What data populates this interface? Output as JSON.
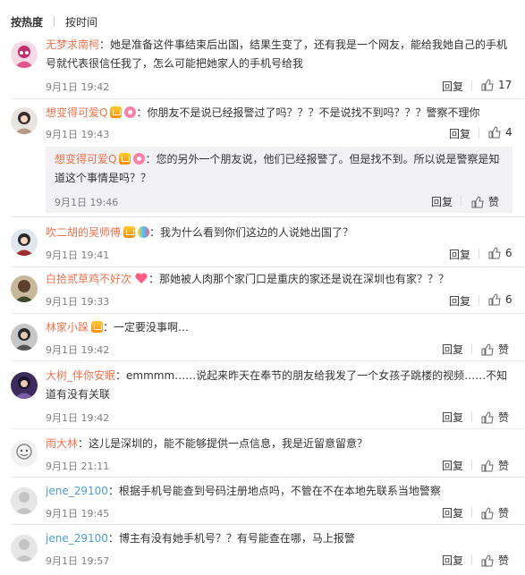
{
  "tabs": {
    "hot": "按热度",
    "time": "按时间"
  },
  "actions": {
    "reply": "回复",
    "like_icon": "thumbs-up-icon",
    "zan": "赞"
  },
  "colors": {
    "username_orange": "#eb7350",
    "username_blue": "#4b9cd6",
    "meta_gray": "#808080"
  },
  "comments": [
    {
      "user": "无梦求南柯",
      "text": "：她是准备这件事结束后出国，结果生变了，还有我是一个网友，能给我她自己的手机号就代表很信任我了，怎么可能把她家人的手机号给我",
      "time": "9月1日 19:42",
      "likes": "17"
    },
    {
      "user": "想变得可爱Q",
      "text": "：你朋友不是说已经报警过了吗？？？不是说找不到吗？？？警察不理你",
      "time": "9月1日 19:43",
      "likes": "4",
      "sub": {
        "user": "想变得可爱Q",
        "text": "：您的另外一个朋友说，他们已经报警了。但是找不到。所以说是警察是知道这个事情是吗？？",
        "time": "9月1日 19:46",
        "likes": "赞"
      }
    },
    {
      "user": "吹二胡的吴师傅",
      "text": "：我为什么看到你们这边的人说她出国了？",
      "time": "9月1日 19:41",
      "likes": "6"
    },
    {
      "user": "白拾贰草鸡不好次",
      "text": "：那她被人肉那个家门口是重庆的家还是说在深圳也有家？？？",
      "time": "9月1日 19:33",
      "likes": "6"
    },
    {
      "user": "林家小跺",
      "text": "：一定要没事啊…",
      "time": "9月1日 19:42",
      "likes": "赞"
    },
    {
      "user": "大树_伴你安眠",
      "text": "：emmmm……说起来昨天在奉节的朋友给我发了一个女孩子跳楼的视频……不知道有没有关联",
      "time": "9月1日 19:42",
      "likes": "赞"
    },
    {
      "user": "雨大林",
      "text": "：这儿是深圳的，能不能够提供一点信息，我是近留意留意？",
      "time": "9月1日 21:11",
      "likes": "赞"
    },
    {
      "user": "jene_29100",
      "text": "：根据手机号能查到号码注册地点吗，不管在不在本地先联系当地警察",
      "time": "9月1日 19:45",
      "likes": "赞"
    },
    {
      "user": "jene_29100",
      "text": "：博主有没有她手机号？？有号能查在哪，马上报警",
      "time": "9月1日 19:57",
      "likes": "赞"
    }
  ]
}
